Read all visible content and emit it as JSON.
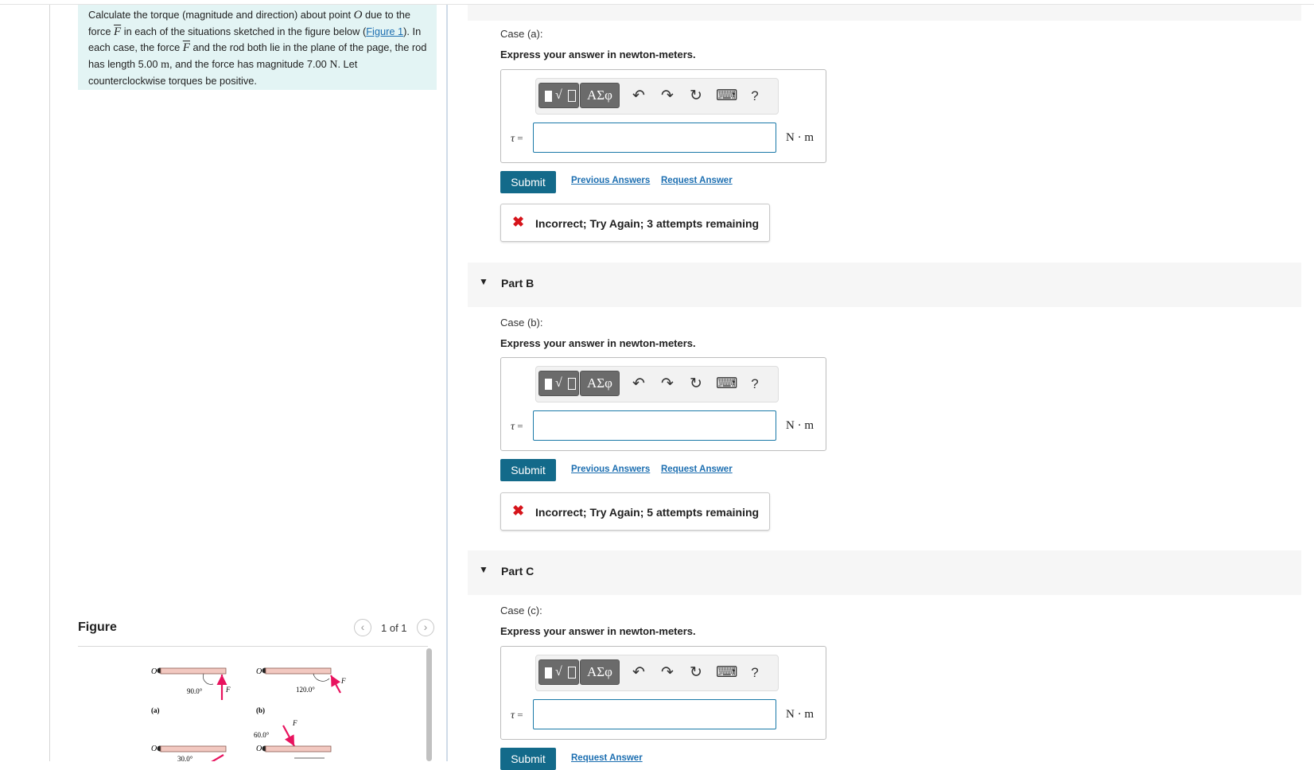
{
  "problem": {
    "t1": "Calculate the torque (magnitude and direction) about point ",
    "point": "O",
    "t2": " due to the force ",
    "force": "F",
    "t3": " in each of the situations sketched in the figure below (",
    "figure_link": "Figure 1",
    "t4": "). In each case, the force ",
    "t5": " and the rod both lie in the plane of the page, the rod has length 5.00 ",
    "len_unit": "m",
    "t6": ", and the force has magnitude 7.00 ",
    "force_unit": "N",
    "t7": ". Let counterclockwise torques be positive."
  },
  "figure": {
    "title": "Figure",
    "pager": "1 of 1",
    "prev_icon": "chevron-left-icon",
    "next_icon": "chevron-right-icon",
    "labels": {
      "point": "O",
      "force": "F",
      "a": "(a)",
      "b": "(b)",
      "angle_a": "90.0°",
      "angle_b": "120.0°",
      "angle_c": "30.0°",
      "angle_d": "60.0°"
    },
    "colors": {
      "rod": "#f2c8c0",
      "force": "#e8135e"
    }
  },
  "toolbar": {
    "greek": "ΑΣφ",
    "radical": "√",
    "undo_icon": "↶",
    "redo_icon": "↷",
    "reset_icon": "↻",
    "keyboard_icon": "⌨",
    "help": "?"
  },
  "parts": {
    "a": {
      "case": "Case (a):",
      "express": "Express your answer in newton-meters.",
      "var": "τ",
      "eq": " =",
      "value": "",
      "unit": "N · m",
      "submit": "Submit",
      "prev_answers": "Previous Answers",
      "request_answer": "Request Answer",
      "feedback_icon": "✖",
      "feedback": "Incorrect; Try Again; 3 attempts remaining"
    },
    "b": {
      "title": "Part B",
      "case": "Case (b):",
      "express": "Express your answer in newton-meters.",
      "var": "τ",
      "eq": " =",
      "value": "",
      "unit": "N · m",
      "submit": "Submit",
      "prev_answers": "Previous Answers",
      "request_answer": "Request Answer",
      "feedback_icon": "✖",
      "feedback": "Incorrect; Try Again; 5 attempts remaining"
    },
    "c": {
      "title": "Part C",
      "case": "Case (c):",
      "express": "Express your answer in newton-meters.",
      "var": "τ",
      "eq": " =",
      "value": "",
      "unit": "N · m",
      "submit": "Submit",
      "request_answer": "Request Answer"
    }
  },
  "colors": {
    "accent": "#136a8a",
    "link": "#1d6fb1",
    "error": "#d6141b",
    "problem_bg": "#e3f4f4"
  }
}
